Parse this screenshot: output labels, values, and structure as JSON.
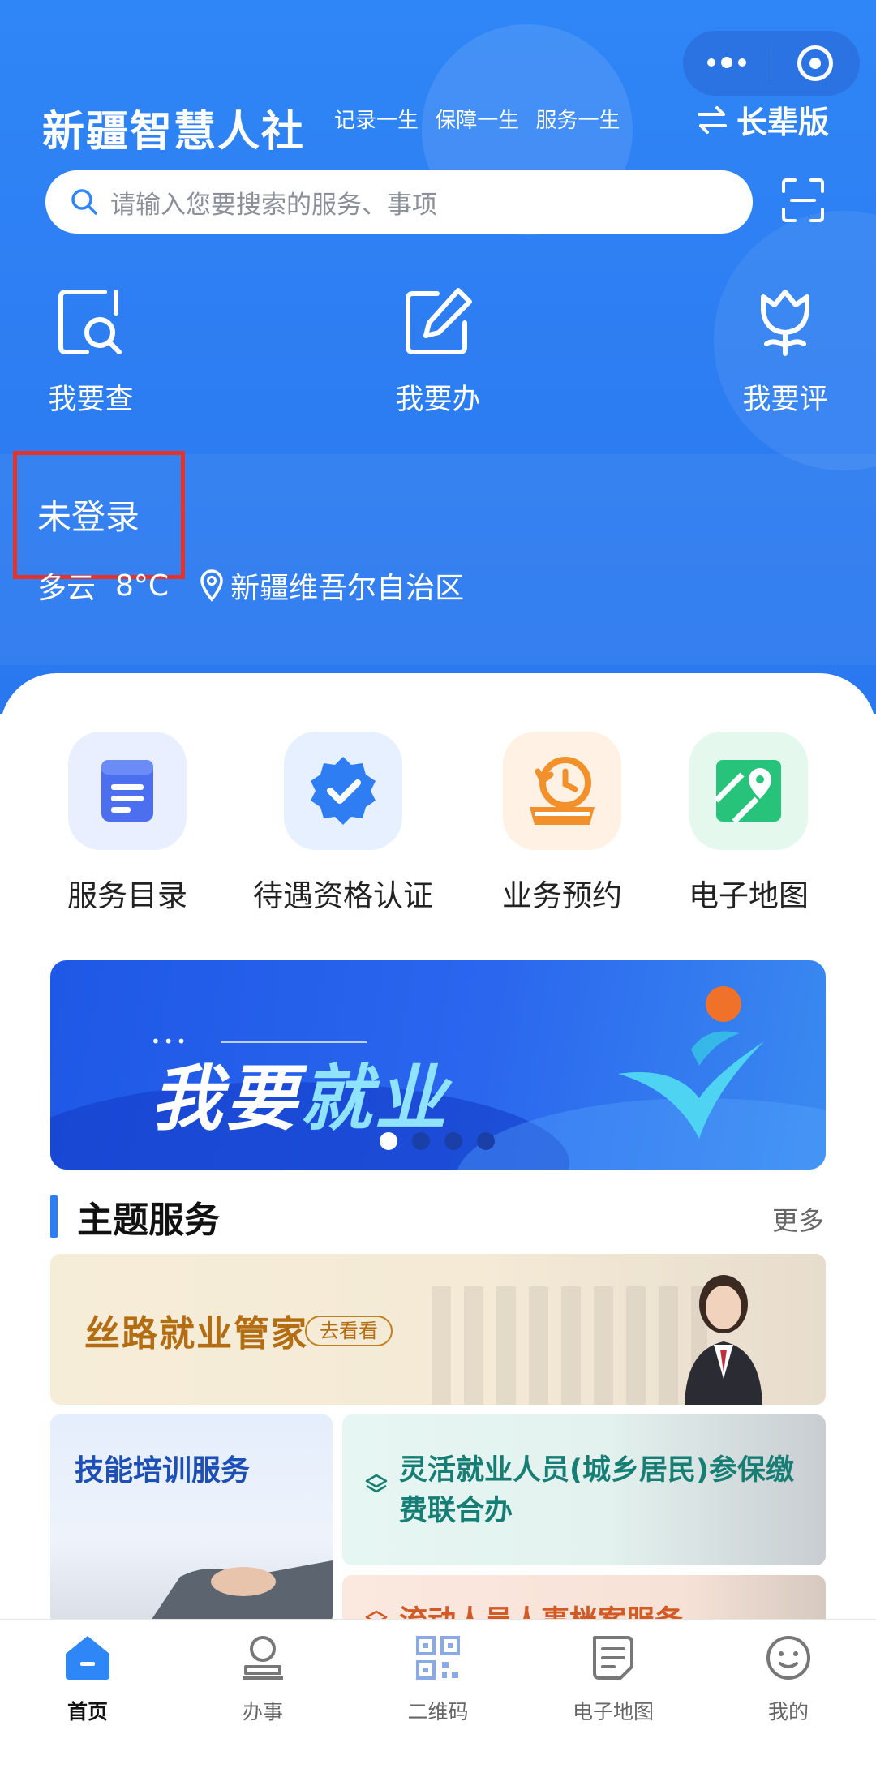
{
  "header": {
    "app_title": "新疆智慧人社",
    "slogan": "记录一生 保障一生 服务一生",
    "elder_mode": "长辈版",
    "search_placeholder": "请输入您要搜索的服务、事项"
  },
  "quick_actions": [
    {
      "label": "我要查",
      "icon": "search-doc-icon"
    },
    {
      "label": "我要办",
      "icon": "edit-icon"
    },
    {
      "label": "我要评",
      "icon": "flower-icon"
    }
  ],
  "user": {
    "login_status": "未登录",
    "weather": "多云",
    "temperature": "8°C",
    "location": "新疆维吾尔自治区"
  },
  "services": [
    {
      "label": "服务目录",
      "icon": "catalog-icon",
      "color": "#4c6ff0"
    },
    {
      "label": "待遇资格认证",
      "icon": "verify-badge-icon",
      "color": "#2f7df3"
    },
    {
      "label": "业务预约",
      "icon": "appointment-icon",
      "color": "#f2912b"
    },
    {
      "label": "电子地图",
      "icon": "map-icon",
      "color": "#27c37a"
    }
  ],
  "banner": {
    "text_main": "我要",
    "text_highlight": "就业",
    "slides": 4,
    "active_slide": 1
  },
  "theme_services": {
    "title": "主题服务",
    "more": "更多",
    "cards": [
      {
        "title": "丝路就业管家",
        "button": "去看看"
      },
      {
        "title": "技能培训服务"
      },
      {
        "title": "灵活就业人员(城乡居民)参保缴费联合办"
      },
      {
        "title": "流动人员人事档案服务"
      }
    ]
  },
  "tabbar": [
    {
      "label": "首页",
      "icon": "home-icon",
      "active": true
    },
    {
      "label": "办事",
      "icon": "person-icon",
      "active": false
    },
    {
      "label": "二维码",
      "icon": "qrcode-icon",
      "active": false
    },
    {
      "label": "电子地图",
      "icon": "document-icon",
      "active": false
    },
    {
      "label": "我的",
      "icon": "smile-icon",
      "active": false
    }
  ],
  "colors": {
    "primary": "#2f86f6",
    "alert_box": "#e5332a",
    "gold": "#b36d12",
    "teal": "#167e74"
  }
}
